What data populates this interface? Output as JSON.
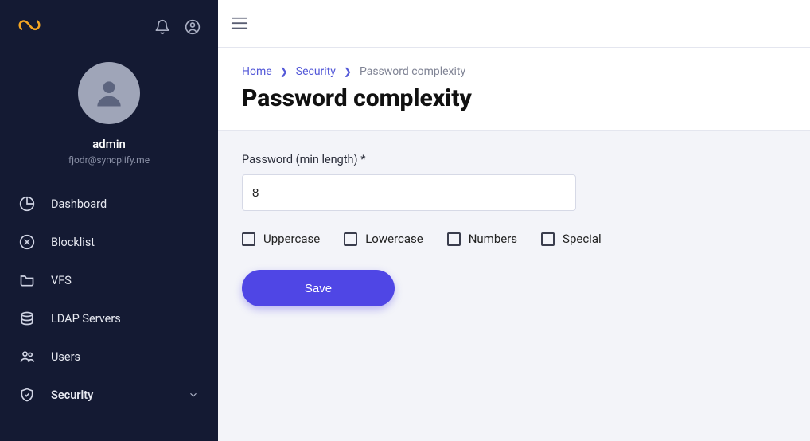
{
  "sidebar": {
    "user": {
      "name": "admin",
      "email": "fjodr@syncplify.me"
    },
    "items": [
      {
        "label": "Dashboard",
        "icon": "pie-chart-icon"
      },
      {
        "label": "Blocklist",
        "icon": "x-circle-icon"
      },
      {
        "label": "VFS",
        "icon": "folder-icon"
      },
      {
        "label": "LDAP Servers",
        "icon": "server-icon"
      },
      {
        "label": "Users",
        "icon": "users-icon"
      },
      {
        "label": "Security",
        "icon": "shield-icon",
        "expandable": true,
        "active": true
      }
    ]
  },
  "breadcrumb": {
    "home": "Home",
    "parent": "Security",
    "current": "Password complexity"
  },
  "page": {
    "title": "Password complexity",
    "form": {
      "min_length_label": "Password (min length) *",
      "min_length_value": "8",
      "checks": {
        "uppercase": {
          "label": "Uppercase",
          "checked": false
        },
        "lowercase": {
          "label": "Lowercase",
          "checked": false
        },
        "numbers": {
          "label": "Numbers",
          "checked": false
        },
        "special": {
          "label": "Special",
          "checked": false
        }
      },
      "save_label": "Save"
    }
  }
}
